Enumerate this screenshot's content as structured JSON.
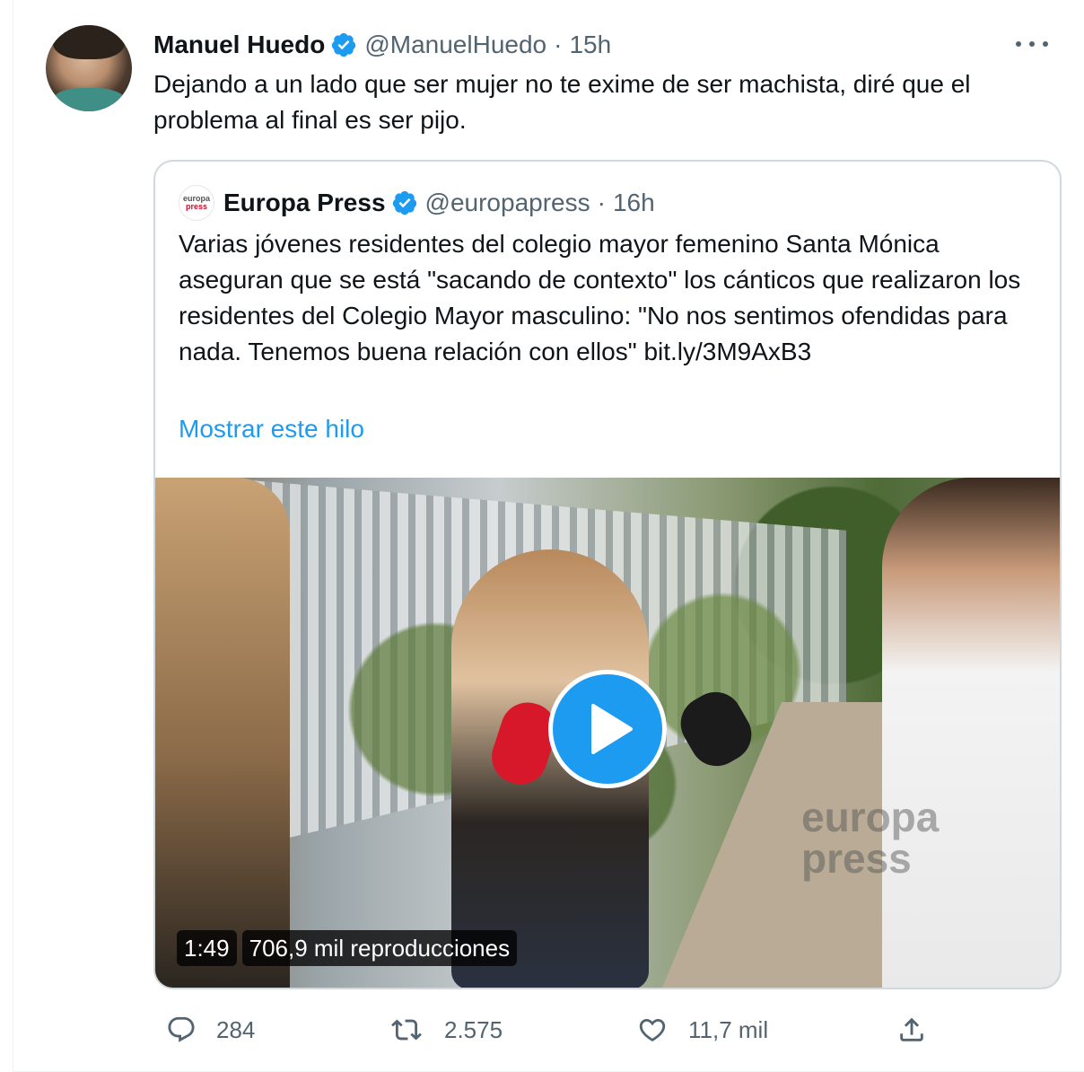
{
  "tweet": {
    "author": {
      "name": "Manuel Huedo",
      "handle": "@ManuelHuedo",
      "time": "15h",
      "separator": "·"
    },
    "text": "Dejando a un lado que ser mujer no te exime de ser machista, diré que el problema al final es ser pijo.",
    "quote": {
      "logo_top": "europa",
      "logo_bottom": "press",
      "name": "Europa Press",
      "handle": "@europapress",
      "time": "16h",
      "separator": "·",
      "text": "Varias jóvenes residentes del colegio mayor femenino Santa Mónica aseguran que se está \"sacando de contexto\" los cánticos que realizaron los residentes del Colegio Mayor masculino: \"No nos sentimos ofendidas para nada. Tenemos buena relación con ellos\" bit.ly/3M9AxB3",
      "show_thread": "Mostrar este hilo",
      "video": {
        "duration": "1:49",
        "views": "706,9 mil reproducciones",
        "watermark_line1": "europa",
        "watermark_line2": "press"
      }
    },
    "actions": {
      "replies": "284",
      "retweets": "2.575",
      "likes": "11,7 mil"
    }
  },
  "colors": {
    "accent": "#1d9bf0",
    "secondary_text": "#536471",
    "border": "#cfd9de"
  },
  "icons": [
    "verified-icon",
    "more-icon",
    "reply-icon",
    "retweet-icon",
    "like-icon",
    "share-icon",
    "play-icon"
  ]
}
